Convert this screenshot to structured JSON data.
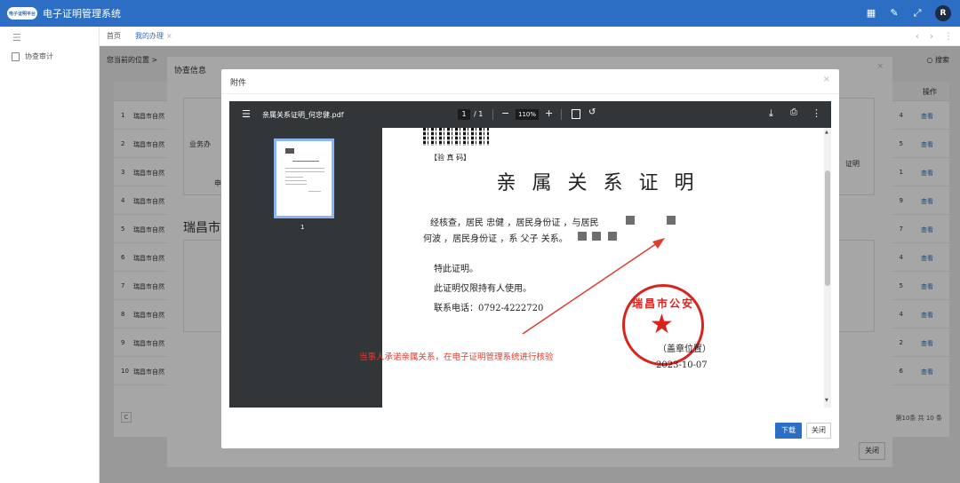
{
  "app": {
    "logo_text": "电子证明平台",
    "title": "电子证明管理系统",
    "user_initial": "R"
  },
  "sidebar": {
    "items": [
      {
        "label": "协查审计"
      }
    ]
  },
  "tabs": [
    {
      "label": "首页"
    },
    {
      "label": "我的办理"
    }
  ],
  "main": {
    "location": "您当前的位置 >",
    "search_label": "搜索",
    "op_header": "操作",
    "rows": [
      {
        "no": "1",
        "name": "瑞昌市自然",
        "num": "4",
        "action": "查看"
      },
      {
        "no": "2",
        "name": "瑞昌市自然",
        "num": "5",
        "action": "查看"
      },
      {
        "no": "3",
        "name": "瑞昌市自然",
        "num": "1",
        "action": "查看"
      },
      {
        "no": "4",
        "name": "瑞昌市自然",
        "num": "9",
        "action": "查看"
      },
      {
        "no": "5",
        "name": "瑞昌市自然",
        "num": "7",
        "action": "查看"
      },
      {
        "no": "6",
        "name": "瑞昌市自然",
        "num": "4",
        "action": "查看"
      },
      {
        "no": "7",
        "name": "瑞昌市自然",
        "num": "5",
        "action": "查看"
      },
      {
        "no": "8",
        "name": "瑞昌市自然",
        "num": "4",
        "action": "查看"
      },
      {
        "no": "9",
        "name": "瑞昌市自然",
        "num": "2",
        "action": "查看"
      },
      {
        "no": "10",
        "name": "瑞昌市自然",
        "num": "6",
        "action": "查看"
      }
    ],
    "pager_text": "第10条 共 10 条"
  },
  "mid_dialog": {
    "title": "协查信息",
    "labels": [
      "业务办",
      "申",
      "申",
      "证明"
    ],
    "big_text": "瑞昌市",
    "close_label": "关闭"
  },
  "dialog": {
    "title": "附件",
    "download_label": "下载",
    "close_label": "关闭"
  },
  "pdf": {
    "filename": "亲属关系证明_何忠健.pdf",
    "page_current": "1",
    "page_total": "/ 1",
    "zoom": "110%",
    "thumb_page": "1",
    "verify_code_label": "【验 真 码】",
    "doc_title": "亲属关系证明",
    "line1": "经核查，居民  忠健  ，居民身份证              ，与居民",
    "line2": "何波  ，居民身份证                  ，系 父子  关系。",
    "line3": "特此证明。",
    "line4": "此证明仅限持有人使用。",
    "line5": "联系电话：0792-4222720",
    "stamp_text": "瑞昌市公安",
    "stamp_label": "（盖章位置）",
    "stamp_date": "2023-10-07"
  },
  "annotation": "当事人承诺亲属关系，在电子证明管理系统进行核验",
  "colors": {
    "brand": "#2b6ec3",
    "stamp": "#d9231d",
    "annotation": "#e23b2e"
  }
}
